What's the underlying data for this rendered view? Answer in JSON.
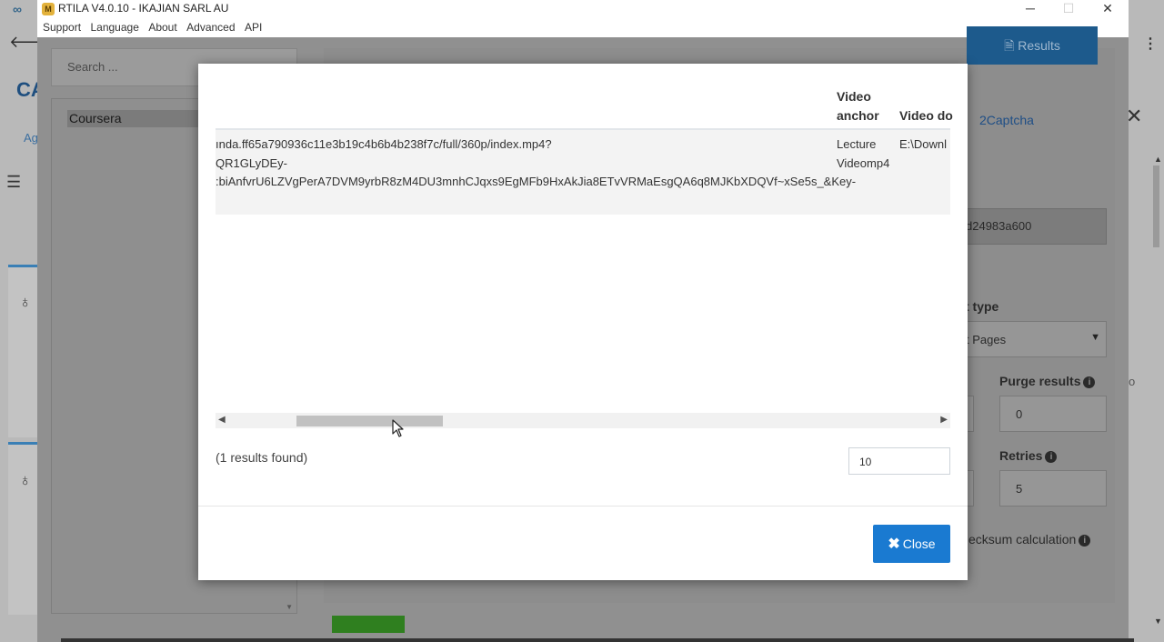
{
  "window": {
    "title": "RTILA V4.0.10 - IKAJIAN SARL AU",
    "logo_text": "M",
    "controls": {
      "minimize": "─",
      "maximize": "☐",
      "close": "✕"
    }
  },
  "menu": [
    "Support",
    "Language",
    "About",
    "Advanced",
    "API"
  ],
  "outer_browser": {
    "tab_icon": "∞",
    "back_icon": "🡐",
    "brand_partial": "CA",
    "nav_partial": "Ag",
    "menu_dots": "⋮",
    "right_partial_text": "o"
  },
  "background": {
    "search_placeholder": "Search ...",
    "sidebar_item": "Coursera",
    "results_button": "Results",
    "captcha_link": "2Captcha",
    "hash_value": "d24983a600",
    "result_type_label": "t type",
    "result_type_value": "t Pages",
    "purge_label": "Purge results",
    "purge_value": "0",
    "retries_label": "Retries",
    "retries_value": "5",
    "checksum_label": "ecksum calculation",
    "info_icon": "i"
  },
  "modal": {
    "columns": [
      {
        "line1": "Video",
        "line2": "anchor"
      },
      {
        "line1": "",
        "line2": "Video do"
      }
    ],
    "row": {
      "url_lines": [
        "ında.ff65a790936c11e3b19c4b6b4b238f7c/full/360p/index.mp4?",
        "QR1GLyDEy-",
        ":biAnfvrU6LZVgPerA7DVM9yrbR8zM4DU3mnhCJqxs9EgMFb9HxAkJia8ETvVRMaEsgQA6q8MJKbXDQVf~xSe5s_&Key-"
      ],
      "video_anchor_lines": [
        "Lecture",
        "Videomp4"
      ],
      "video_download": "E:\\Downl"
    },
    "scroll_left": "◀",
    "scroll_right": "▶",
    "results_found": "(1 results found)",
    "page_size": "10",
    "close_label": "Close",
    "close_icon": "✖"
  }
}
